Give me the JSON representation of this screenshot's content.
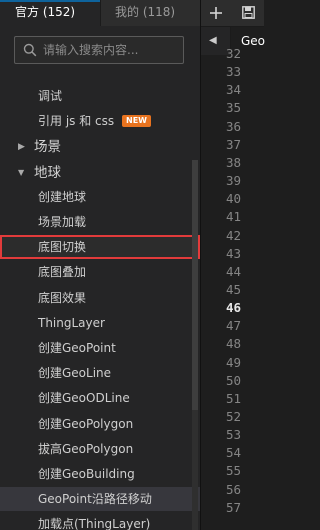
{
  "sidebar": {
    "tabs": [
      {
        "label": "官方 (152)"
      },
      {
        "label": "我的 (118)"
      }
    ],
    "search_placeholder": "请输入搜索内容...",
    "items": [
      {
        "label": "调试",
        "kind": "item"
      },
      {
        "label": "引用 js 和 css",
        "kind": "item",
        "badge": "NEW"
      },
      {
        "label": "场景",
        "kind": "group",
        "expanded": false
      },
      {
        "label": "地球",
        "kind": "group",
        "expanded": true
      },
      {
        "label": "创建地球",
        "kind": "item"
      },
      {
        "label": "场景加载",
        "kind": "item"
      },
      {
        "label": "底图切换",
        "kind": "item",
        "highlighted": true
      },
      {
        "label": "底图叠加",
        "kind": "item"
      },
      {
        "label": "底图效果",
        "kind": "item"
      },
      {
        "label": "ThingLayer",
        "kind": "item"
      },
      {
        "label": "创建GeoPoint",
        "kind": "item"
      },
      {
        "label": "创建GeoLine",
        "kind": "item"
      },
      {
        "label": "创建GeoODLine",
        "kind": "item"
      },
      {
        "label": "创建GeoPolygon",
        "kind": "item"
      },
      {
        "label": "拔高GeoPolygon",
        "kind": "item"
      },
      {
        "label": "创建GeoBuilding",
        "kind": "item"
      },
      {
        "label": "GeoPoint沿路径移动",
        "kind": "item",
        "selected": true
      },
      {
        "label": "加载点(ThingLayer)",
        "kind": "item"
      }
    ]
  },
  "editor": {
    "tab_label": "Geo",
    "line_numbers": [
      "32",
      "33",
      "34",
      "35",
      "36",
      "37",
      "38",
      "39",
      "40",
      "41",
      "42",
      "43",
      "44",
      "45",
      "46",
      "47",
      "48",
      "49",
      "50",
      "51",
      "52",
      "53",
      "54",
      "55",
      "56",
      "57"
    ],
    "current_line": "46"
  },
  "colors": {
    "highlight_outline": "#e23b3b",
    "badge": "#e8731f",
    "active_tab_accent": "#0e639c"
  },
  "icons": {
    "search": "search-icon",
    "add": "plus-icon",
    "save": "save-icon",
    "tab_scroll": "triangle-left-icon"
  }
}
